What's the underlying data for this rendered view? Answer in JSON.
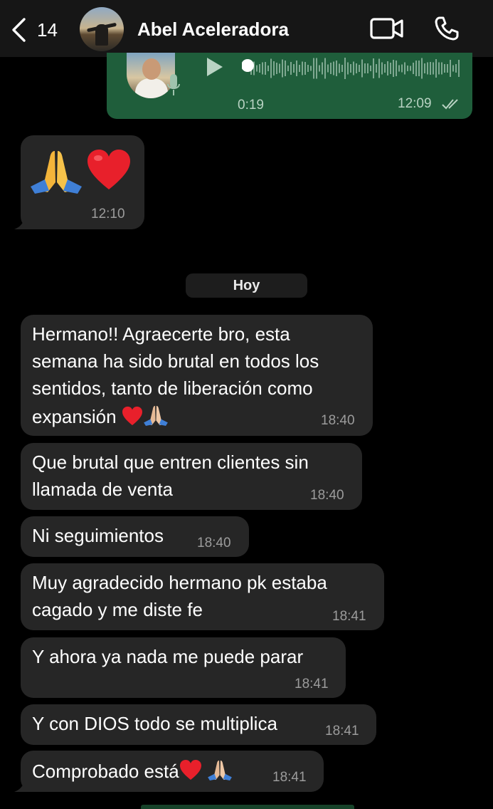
{
  "header": {
    "unread_count": "14",
    "contact_name": "Abel Aceleradora",
    "icons": [
      "back-chevron-icon",
      "video-call-icon",
      "phone-icon"
    ]
  },
  "voice_message": {
    "duration": "0:19",
    "time": "12:09",
    "status": "delivered-ticks",
    "progress": 0
  },
  "reaction_message": {
    "emojis": [
      "folded-hands",
      "red-heart"
    ],
    "time": "12:10"
  },
  "date_separator": "Hoy",
  "messages": [
    {
      "lines": [
        "Hermano!! Agraecerte bro, esta",
        "semana ha sido brutal en todos los",
        "sentidos, tanto de liberación como",
        "expansión"
      ],
      "trailing_emojis": [
        "red-heart",
        "folded-hands"
      ],
      "time": "18:40"
    },
    {
      "lines": [
        "Que brutal que entren clientes sin",
        "llamada de venta"
      ],
      "time": "18:40"
    },
    {
      "lines": [
        "Ni seguimientos"
      ],
      "time": "18:40"
    },
    {
      "lines": [
        "Muy agradecido hermano pk estaba",
        "cagado y me diste fe"
      ],
      "time": "18:41"
    },
    {
      "lines": [
        "Y ahora ya nada me puede parar"
      ],
      "time": "18:41"
    },
    {
      "lines": [
        "Y con DIOS todo se multiplica"
      ],
      "time": "18:41"
    },
    {
      "lines": [
        "Comprobado está"
      ],
      "trailing_emojis": [
        "red-heart",
        "folded-hands"
      ],
      "time": "18:41"
    }
  ],
  "colors": {
    "background": "#000000",
    "header": "#161616",
    "incoming_bubble": "#262626",
    "outgoing_bubble": "#1f5e3b",
    "timestamp": "#9c9c9c",
    "heart": "#e8202b"
  }
}
